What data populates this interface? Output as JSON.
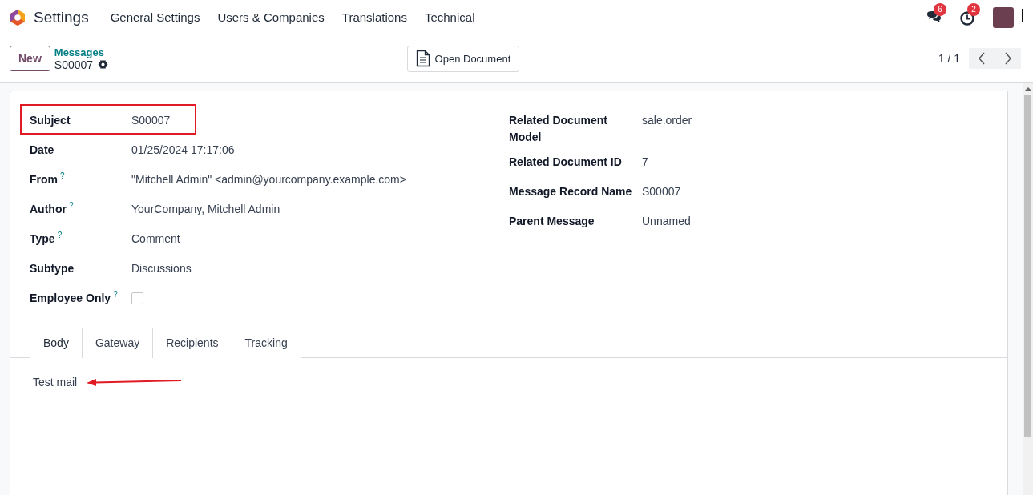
{
  "app": {
    "title": "Settings"
  },
  "menu": [
    {
      "label": "General Settings"
    },
    {
      "label": "Users & Companies"
    },
    {
      "label": "Translations"
    },
    {
      "label": "Technical"
    }
  ],
  "systray": {
    "messages_count": "6",
    "activities_count": "2"
  },
  "control_panel": {
    "new_button": "New",
    "breadcrumb": "Messages",
    "record_name": "S00007",
    "action_button": "Open Document",
    "pager": "1 / 1"
  },
  "left_fields": [
    {
      "label": "Subject",
      "value": "S00007",
      "help": false,
      "highlighted": true,
      "kind": "text"
    },
    {
      "label": "Date",
      "value": "01/25/2024 17:17:06",
      "help": false,
      "highlighted": false,
      "kind": "text"
    },
    {
      "label": "From",
      "value": "\"Mitchell Admin\" <admin@yourcompany.example.com>",
      "help": true,
      "highlighted": false,
      "kind": "text"
    },
    {
      "label": "Author",
      "value": "YourCompany, Mitchell Admin",
      "help": true,
      "highlighted": false,
      "kind": "text"
    },
    {
      "label": "Type",
      "value": "Comment",
      "help": true,
      "highlighted": false,
      "kind": "text"
    },
    {
      "label": "Subtype",
      "value": "Discussions",
      "help": false,
      "highlighted": false,
      "kind": "text"
    },
    {
      "label": "Employee Only",
      "checked": false,
      "help": true,
      "highlighted": false,
      "kind": "checkbox"
    }
  ],
  "right_fields": [
    {
      "label": "Related Document Model",
      "value": "sale.order",
      "help": false,
      "highlighted": false,
      "kind": "text"
    },
    {
      "label": "Related Document ID",
      "value": "7",
      "help": false,
      "highlighted": false,
      "kind": "text"
    },
    {
      "label": "Message Record Name",
      "value": "S00007",
      "help": false,
      "highlighted": false,
      "kind": "text"
    },
    {
      "label": "Parent Message",
      "value": "Unnamed",
      "help": false,
      "highlighted": false,
      "kind": "text"
    }
  ],
  "help_mark": "?",
  "tabs": [
    {
      "label": "Body",
      "selected": true
    },
    {
      "label": "Gateway",
      "selected": false
    },
    {
      "label": "Recipients",
      "selected": false
    },
    {
      "label": "Tracking",
      "selected": false
    }
  ],
  "body": {
    "text": "Test mail",
    "arrow": true
  }
}
